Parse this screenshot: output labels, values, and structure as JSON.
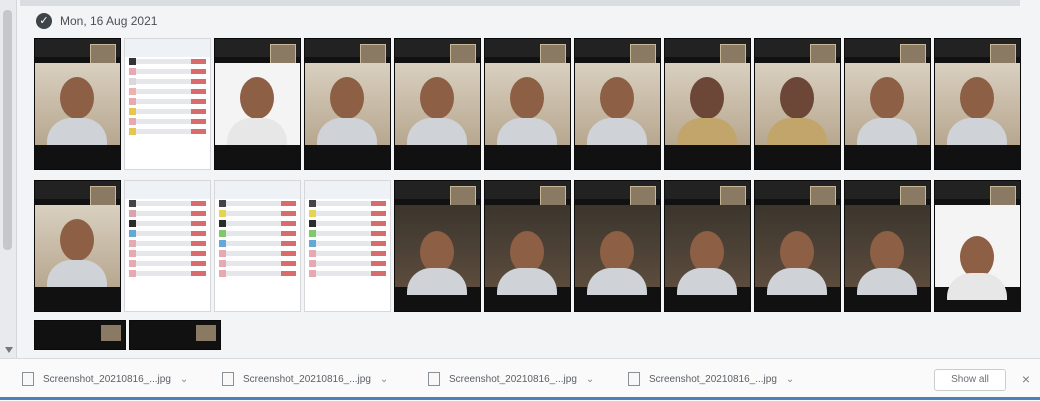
{
  "header": {
    "date_label": "Mon, 16 Aug 2021",
    "check_icon": "check-circle-icon"
  },
  "downloads": {
    "items": [
      {
        "name": "Screenshot_20210816_...jpg"
      },
      {
        "name": "Screenshot_20210816_...jpg"
      },
      {
        "name": "Screenshot_20210816_...jpg"
      },
      {
        "name": "Screenshot_20210816_...jpg"
      }
    ],
    "show_all_label": "Show all",
    "close_label": "×"
  },
  "colors": {
    "accent_bar": "#4a7fc0",
    "download_border": "#c9ccd0",
    "tile_dark": "#111111"
  }
}
